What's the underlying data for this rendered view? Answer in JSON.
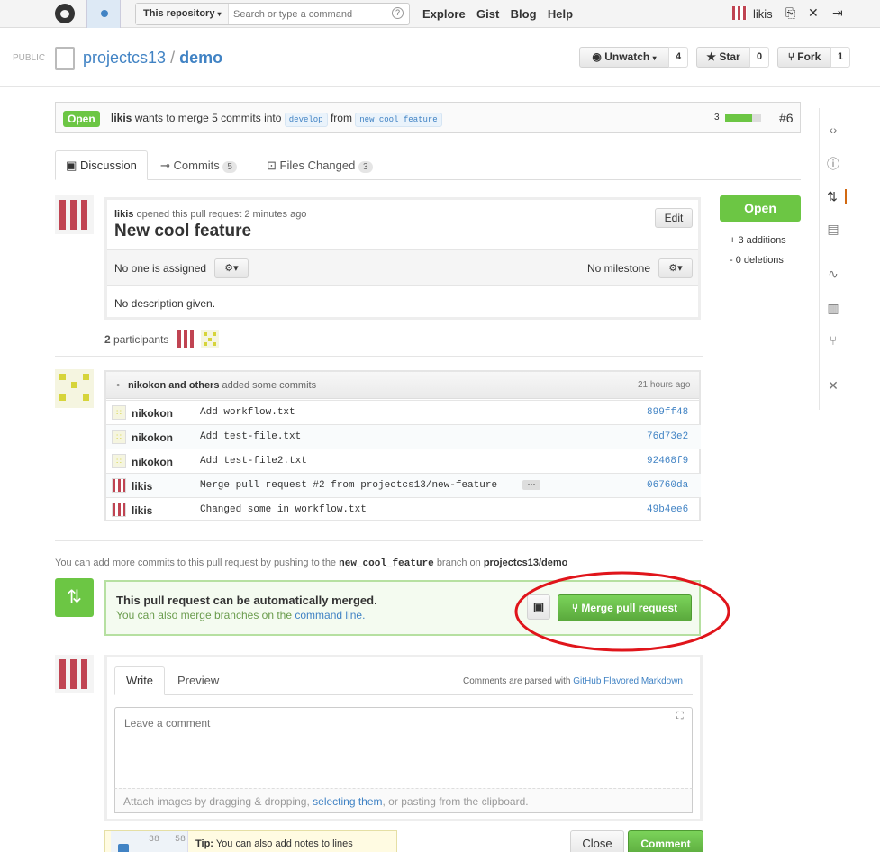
{
  "header": {
    "context_label": "This repository",
    "search_placeholder": "Search or type a command",
    "nav": [
      "Explore",
      "Gist",
      "Blog",
      "Help"
    ],
    "user": "likis"
  },
  "repo": {
    "visibility": "PUBLIC",
    "owner": "projectcs13",
    "separator": "/",
    "name": "demo",
    "unwatch_label": "Unwatch",
    "watch_count": "4",
    "star_label": "Star",
    "star_count": "0",
    "fork_label": "Fork",
    "fork_count": "1"
  },
  "pr": {
    "state": "Open",
    "author": "likis",
    "summary": "wants to merge 5 commits into",
    "base": "develop",
    "from": "from",
    "head": "new_cool_feature",
    "commit_count": "3",
    "number": "#6"
  },
  "tabs": [
    {
      "label": "Discussion",
      "count": ""
    },
    {
      "label": "Commits",
      "count": "5"
    },
    {
      "label": "Files Changed",
      "count": "3"
    }
  ],
  "opening": {
    "author": "likis",
    "meta": "opened this pull request 2 minutes ago",
    "edit": "Edit",
    "title": "New cool feature",
    "assignee": "No one is assigned",
    "milestone": "No milestone",
    "description": "No description given."
  },
  "sidebar": {
    "state_button": "Open",
    "additions": "+ 3 additions",
    "deletions": "- 0 deletions"
  },
  "participants": {
    "count": "2",
    "label": "participants"
  },
  "commits": {
    "header_author": "nikokon and others",
    "header_text": "added some commits",
    "time": "21 hours ago",
    "rows": [
      {
        "author": "nikokon",
        "message": "Add workflow.txt",
        "sha": "899ff48"
      },
      {
        "author": "nikokon",
        "message": "Add test-file.txt",
        "sha": "76d73e2"
      },
      {
        "author": "nikokon",
        "message": "Add test-file2.txt",
        "sha": "92468f9"
      },
      {
        "author": "likis",
        "message": "Merge pull request #2 from projectcs13/new-feature",
        "sha": "06760da"
      },
      {
        "author": "likis",
        "message": "Changed some in workflow.txt",
        "sha": "49b4ee6"
      }
    ]
  },
  "push_hint": {
    "prefix": "You can add more commits to this pull request by pushing to the",
    "branch": "new_cool_feature",
    "middle": "branch on",
    "repo": "projectcs13/demo"
  },
  "merge": {
    "title": "This pull request can be automatically merged.",
    "sub": "You can also merge branches on the",
    "link": "command line.",
    "button": "Merge pull request"
  },
  "comment": {
    "write_tab": "Write",
    "preview_tab": "Preview",
    "parsed_prefix": "Comments are parsed with",
    "parsed_link": "GitHub Flavored Markdown",
    "placeholder": "Leave a comment",
    "attach_prefix": "Attach images by dragging & dropping,",
    "attach_link": "selecting them",
    "attach_suffix": ", or pasting from the clipboard."
  },
  "tip": {
    "line_a1": "38",
    "line_a2": "58",
    "label": "Tip:",
    "text": "You can also add notes to lines"
  },
  "actions": {
    "close": "Close",
    "comment": "Comment"
  },
  "colors": {
    "open_green": "#6cc644",
    "link_blue": "#4183c4",
    "avatar_red": "#c04452",
    "avatar_yellow": "#d6d43a",
    "annotation_red": "#e0151b"
  }
}
